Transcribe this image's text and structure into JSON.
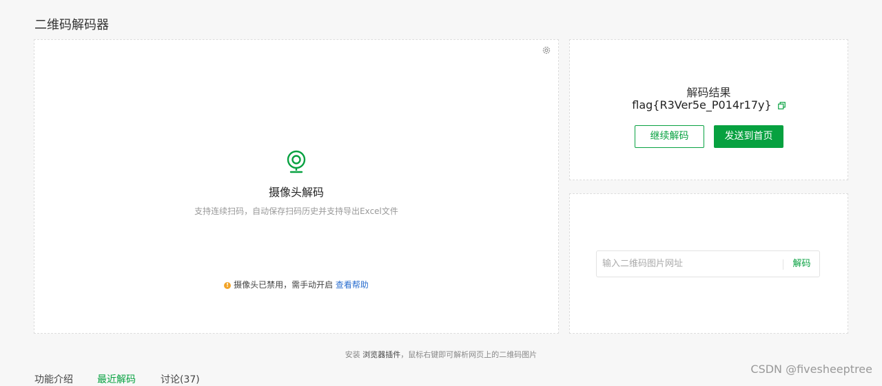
{
  "page": {
    "title": "二维码解码器"
  },
  "camera": {
    "title": "摄像头解码",
    "description": "支持连续扫码，自动保存扫码历史并支持导出Excel文件",
    "warning_text": "摄像头已禁用，需手动开启",
    "help_link": "查看帮助"
  },
  "result": {
    "label": "解码结果",
    "value": "flag{R3Ver5e_P014r17y}",
    "continue_button": "继续解码",
    "send_button": "发送到首页"
  },
  "url_decode": {
    "placeholder": "输入二维码图片网址",
    "button": "解码"
  },
  "install_hint": {
    "prefix": "安装",
    "plugin": "浏览器插件",
    "suffix": "，鼠标右键即可解析网页上的二维码图片"
  },
  "tabs": [
    {
      "label": "功能介绍"
    },
    {
      "label": "最近解码"
    },
    {
      "label": "讨论(37)"
    }
  ],
  "watermark": "CSDN @fivesheeptree",
  "colors": {
    "accent": "#07a140",
    "link": "#2a6ecf",
    "warning": "#f2a428"
  }
}
